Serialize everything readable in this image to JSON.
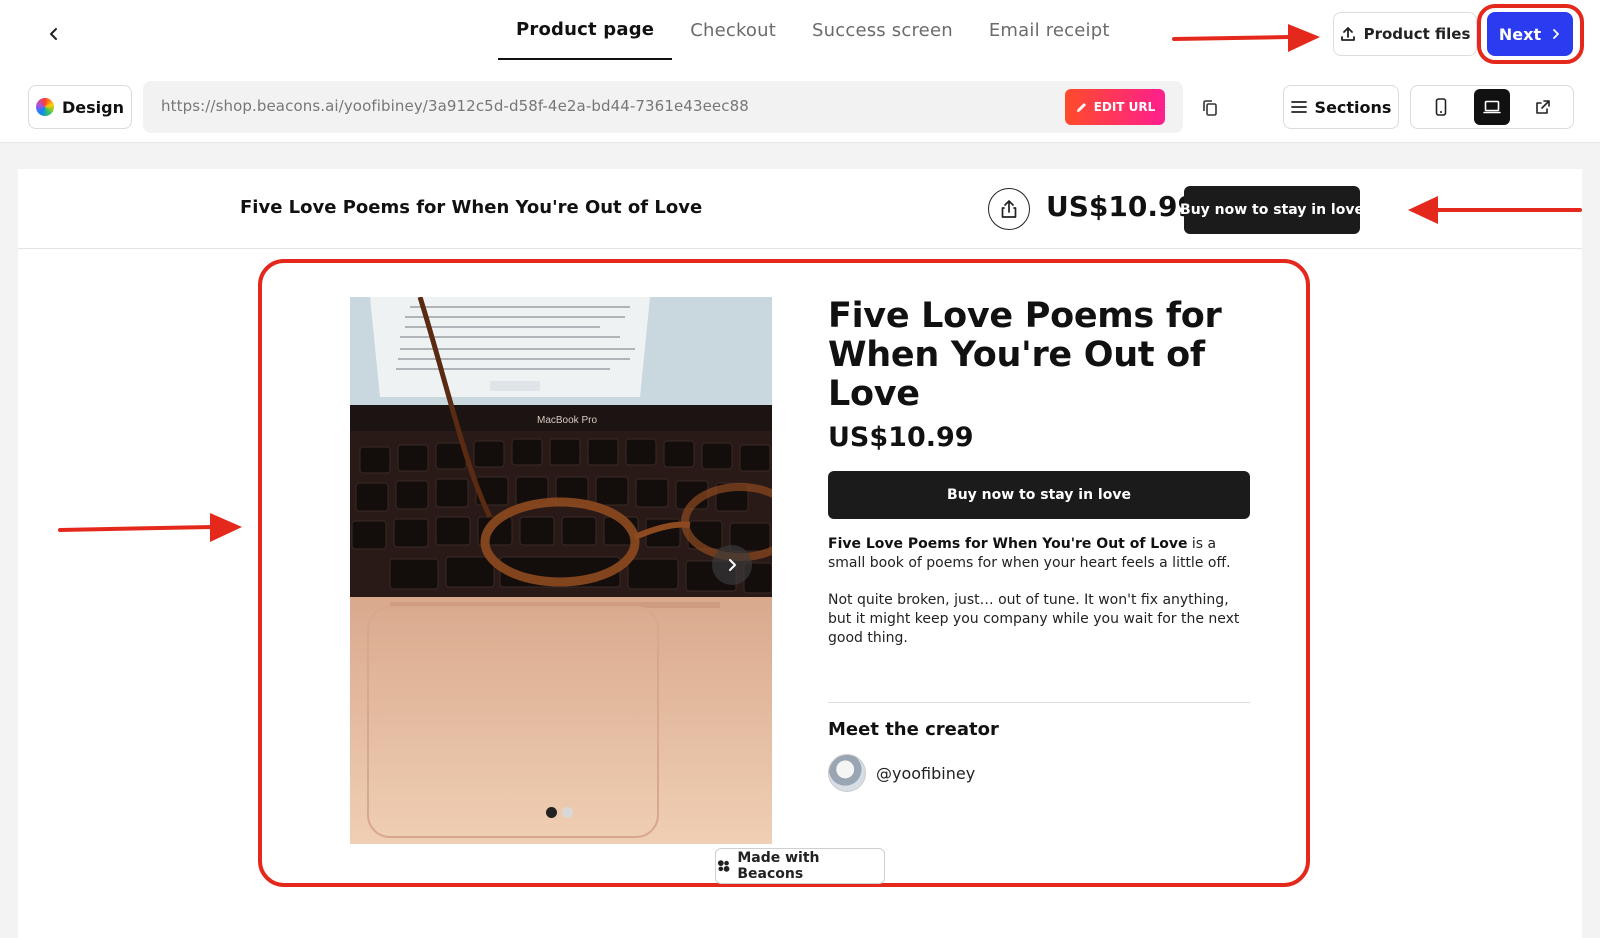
{
  "header": {
    "tabs": [
      {
        "label": "Product page",
        "active": true
      },
      {
        "label": "Checkout",
        "active": false
      },
      {
        "label": "Success screen",
        "active": false
      },
      {
        "label": "Email receipt",
        "active": false
      }
    ],
    "product_files_label": "Product files",
    "next_label": "Next"
  },
  "toolbar": {
    "design_label": "Design",
    "url": "https://shop.beacons.ai/yoofibiney/3a912c5d-d58f-4e2a-bd44-7361e43eec88",
    "edit_url_label": "EDIT URL",
    "sections_label": "Sections",
    "view_mode": "desktop"
  },
  "sticky_bar": {
    "title": "Five Love Poems for When You're Out of Love",
    "price": "US$10.99",
    "buy_label": "Buy now to stay in love"
  },
  "product": {
    "title": "Five Love Poems for When You're Out of Love",
    "price": "US$10.99",
    "buy_label": "Buy now to stay in love",
    "desc_bold": "Five Love Poems for When You're Out of Love",
    "desc_rest": " is a small book of poems for when your heart feels a little off.",
    "desc_second": "Not quite broken, just… out of tune. It won't fix anything, but it might keep you company while you wait for the next good thing.",
    "image_slides": 2,
    "image_current_slide": 1,
    "image_laptop_label": "MacBook Pro"
  },
  "creator": {
    "heading": "Meet the creator",
    "handle": "@yoofibiney"
  },
  "footer": {
    "made_with_label": "Made with Beacons"
  },
  "colors": {
    "annotation_red": "#e4281c",
    "next_blue": "#2b3cf0",
    "button_dark": "#1b1b1b"
  }
}
